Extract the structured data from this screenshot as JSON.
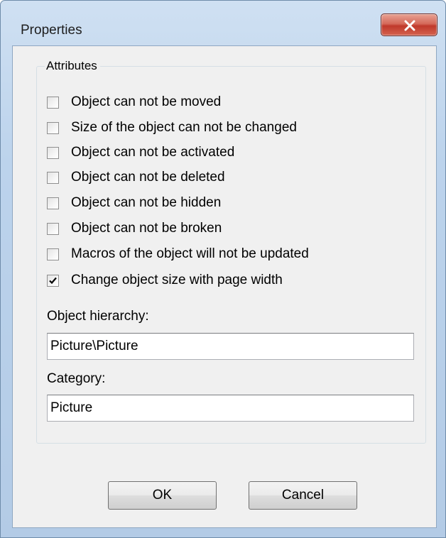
{
  "window": {
    "title": "Properties"
  },
  "attributes": {
    "group_label": "Attributes",
    "options": [
      {
        "label": "Object can not be moved",
        "checked": false
      },
      {
        "label": "Size of the object can not be changed",
        "checked": false
      },
      {
        "label": "Object can not be activated",
        "checked": false
      },
      {
        "label": "Object can not be deleted",
        "checked": false
      },
      {
        "label": "Object can not be hidden",
        "checked": false
      },
      {
        "label": "Object can not be broken",
        "checked": false
      },
      {
        "label": "Macros of the object will not be updated",
        "checked": false
      },
      {
        "label": "Change object size with page width",
        "checked": true
      }
    ]
  },
  "hierarchy": {
    "label": "Object hierarchy:",
    "value": "Picture\\Picture"
  },
  "category": {
    "label": "Category:",
    "value": "Picture"
  },
  "buttons": {
    "ok": "OK",
    "cancel": "Cancel"
  }
}
